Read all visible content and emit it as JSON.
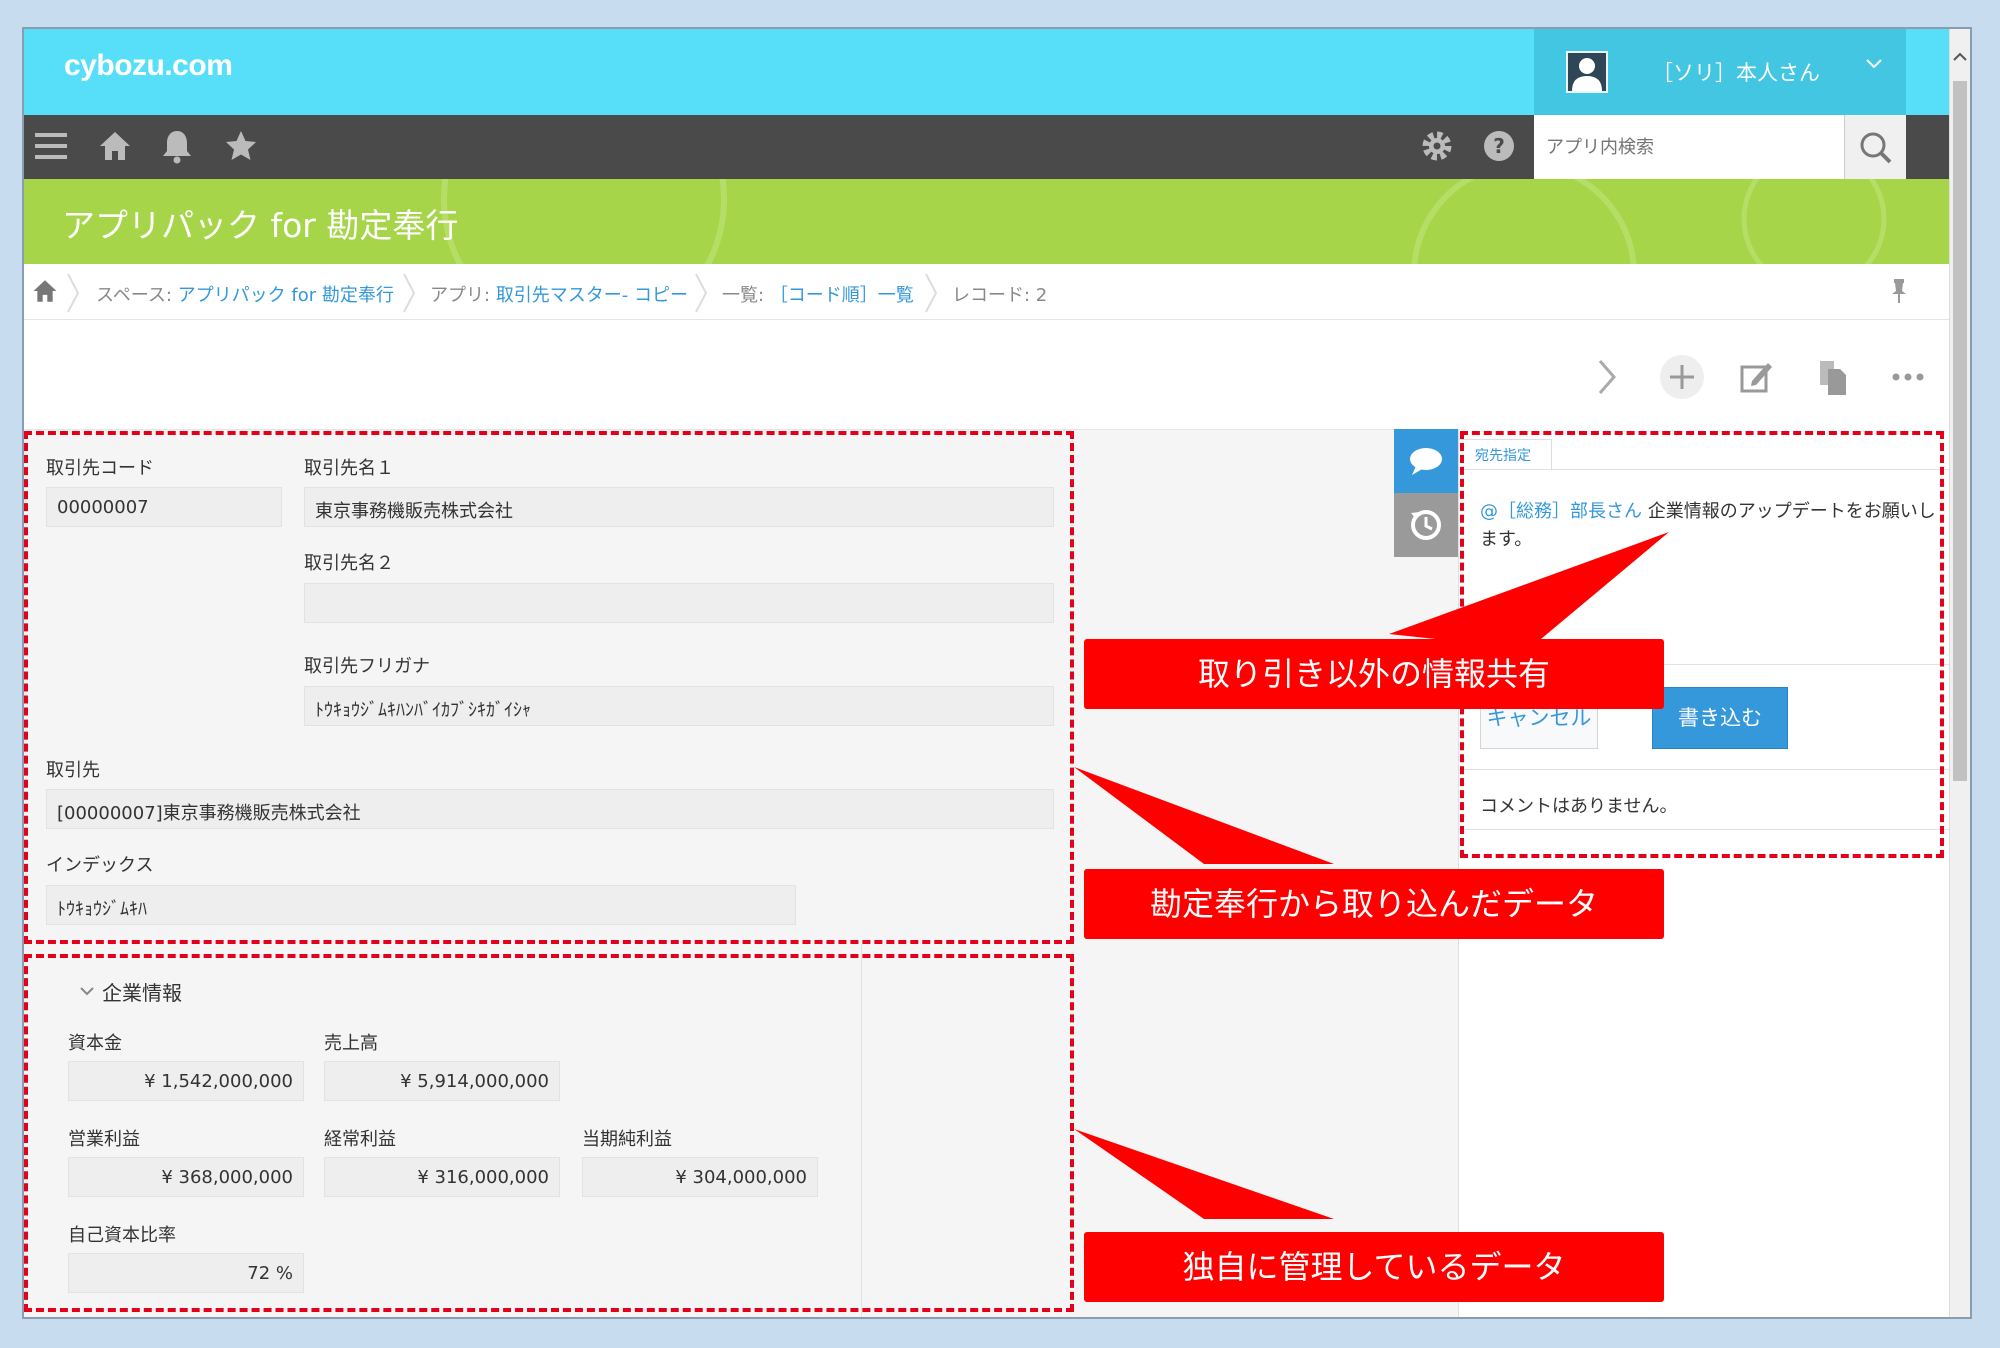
{
  "header": {
    "logo": "cybozu.com",
    "user_name": "［ソリ］本人さん",
    "search_placeholder": "アプリ内検索"
  },
  "app": {
    "title": "アプリパック for 勘定奉行"
  },
  "breadcrumb": {
    "space_label": "スペース:",
    "space_link": "アプリパック for 勘定奉行",
    "app_label": "アプリ:",
    "app_link": "取引先マスター- コピー",
    "view_label": "一覧:",
    "view_link": "［コード順］一覧",
    "record": "レコード: 2"
  },
  "record": {
    "code_label": "取引先コード",
    "code_value": "00000007",
    "name1_label": "取引先名１",
    "name1_value": "東京事務機販売株式会社",
    "name2_label": "取引先名２",
    "name2_value": "",
    "kana_label": "取引先フリガナ",
    "kana_value": "ﾄｳｷｮｳｼﾞﾑｷﾊﾝﾊﾞｲｶﾌﾞｼｷｶﾞｲｼｬ",
    "partner_label": "取引先",
    "partner_value": "[00000007]東京事務機販売株式会社",
    "index_label": "インデックス",
    "index_value": "ﾄｳｷｮｳｼﾞﾑｷﾊ",
    "group_title": "企業情報",
    "capital_label": "資本金",
    "capital_value": "¥ 1,542,000,000",
    "sales_label": "売上高",
    "sales_value": "¥ 5,914,000,000",
    "op_profit_label": "営業利益",
    "op_profit_value": "¥ 368,000,000",
    "ord_profit_label": "経常利益",
    "ord_profit_value": "¥ 316,000,000",
    "net_profit_label": "当期純利益",
    "net_profit_value": "¥ 304,000,000",
    "equity_label": "自己資本比率",
    "equity_value": "72 %"
  },
  "comments": {
    "mention_tab": "宛先指定",
    "mention": "@［総務］部長さん",
    "draft": "企業情報のアップデートをお願いします。",
    "cancel": "キャンセル",
    "post": "書き込む",
    "empty": "コメントはありません。"
  },
  "annotations": {
    "share": "取り引き以外の情報共有",
    "imported": "勘定奉行から取り込んだデータ",
    "custom": "独自に管理しているデータ"
  },
  "colors": {
    "header": "#57dffa",
    "toolbar": "#4a4a4a",
    "title_bar": "#a6d54a",
    "link": "#3498db",
    "annotation": "#ff0000"
  }
}
